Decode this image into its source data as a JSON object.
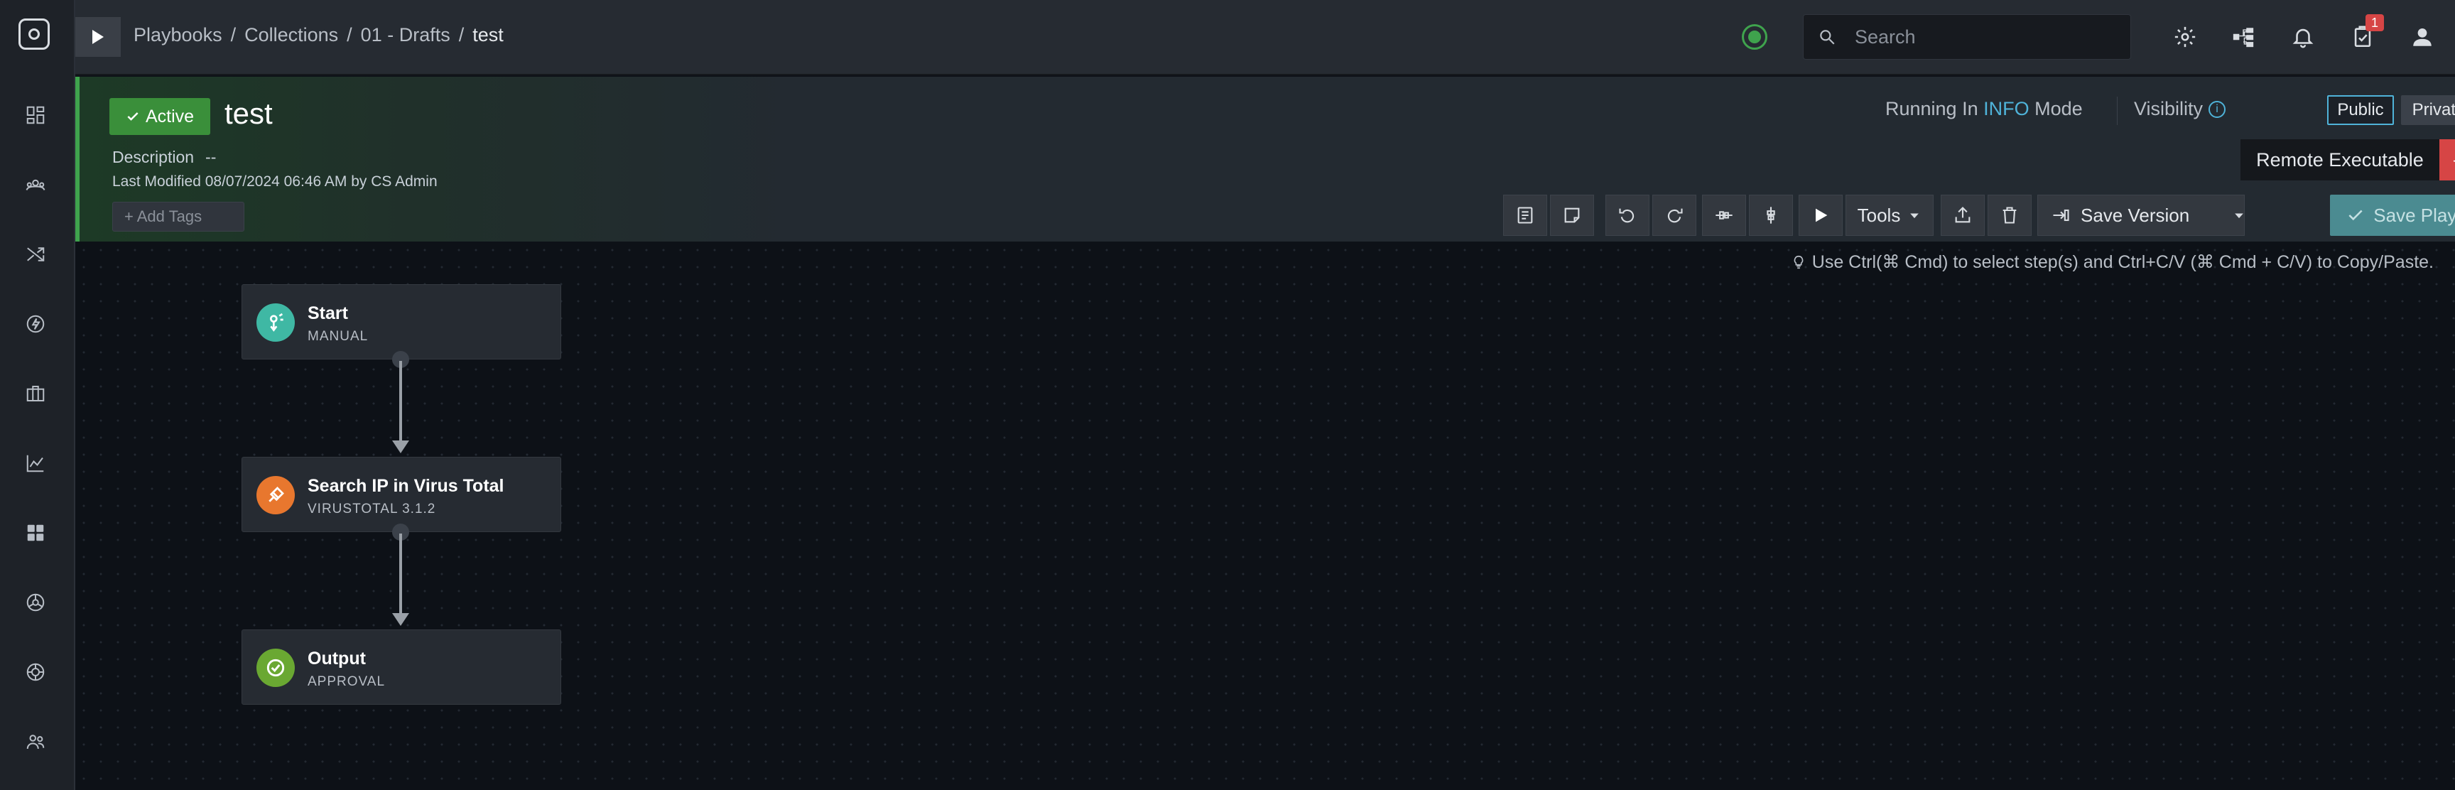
{
  "breadcrumb": [
    "Playbooks",
    "Collections",
    "01 - Drafts",
    "test"
  ],
  "breadcrumb_sep": "/",
  "search": {
    "placeholder": "Search"
  },
  "notifications": {
    "tasks_count": "1"
  },
  "playbook": {
    "status": "Active",
    "title": "test",
    "description_label": "Description",
    "description_value": "--",
    "last_modified": "Last Modified 08/07/2024 06:46 AM by CS Admin",
    "add_tags": "+ Add Tags"
  },
  "mode": {
    "prefix": "Running In",
    "value": "INFO",
    "suffix": "Mode"
  },
  "visibility": {
    "label": "Visibility",
    "public": "Public",
    "private": "Private"
  },
  "remote": {
    "label": "Remote Executable",
    "value": "— No"
  },
  "toolbar": {
    "tools": "Tools",
    "save_version": "Save Version",
    "save_playbook": "Save Playbook"
  },
  "hint": "Use Ctrl(⌘ Cmd) to select step(s) and Ctrl+C/V (⌘ Cmd + C/V) to Copy/Paste.",
  "steps": [
    {
      "name": "Start",
      "sub": "MANUAL",
      "color": "#3fb8a4"
    },
    {
      "name": "Search IP in Virus Total",
      "sub": "VIRUSTOTAL 3.1.2",
      "color": "#e8772e"
    },
    {
      "name": "Output",
      "sub": "APPROVAL",
      "color": "#6aa832"
    }
  ],
  "colors": {
    "accent": "#4fb3d9",
    "active": "#3a8f3a",
    "danger": "#d64545",
    "save": "#4b8b91"
  }
}
